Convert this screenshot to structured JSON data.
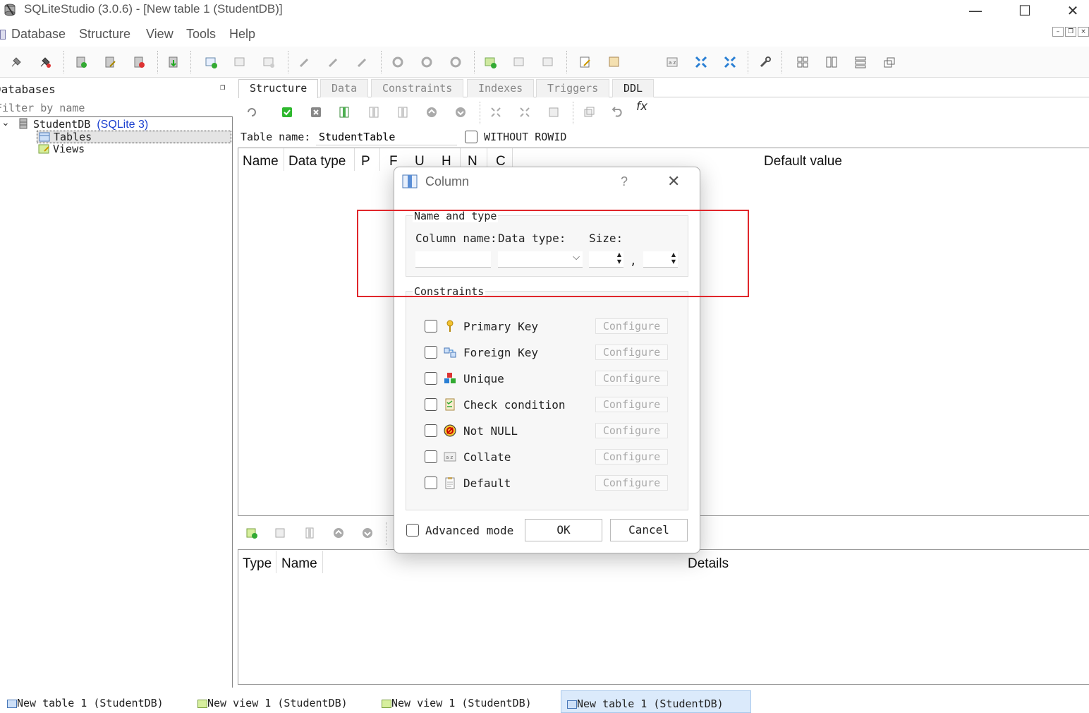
{
  "window": {
    "title": "SQLiteStudio (3.0.6) - [New table 1 (StudentDB)]",
    "minimize": "—",
    "maximize": "☐",
    "close": "✕"
  },
  "menu": [
    "Database",
    "Structure",
    "View",
    "Tools",
    "Help"
  ],
  "db_panel": {
    "header": "Databases",
    "filter_placeholder": "Filter by name",
    "db_name": "StudentDB",
    "db_type": "(SQLite 3)",
    "tables": "Tables",
    "views": "Views"
  },
  "tabs": [
    "Structure",
    "Data",
    "Constraints",
    "Indexes",
    "Triggers",
    "DDL"
  ],
  "structure": {
    "table_name_label": "Table name:",
    "table_name_value": "StudentTable",
    "without_rowid": "WITHOUT ROWID",
    "columns": [
      "Name",
      "Data type",
      "P",
      "F",
      "U",
      "H",
      "N",
      "C",
      "Default value"
    ],
    "constraint_columns": [
      "Type",
      "Name",
      "Details"
    ]
  },
  "dialog": {
    "title": "Column",
    "help": "?",
    "close": "✕",
    "name_type_group": "Name and type",
    "column_name_label": "Column name:",
    "data_type_label": "Data type:",
    "size_label": "Size:",
    "size_separator": ",",
    "constraints_group": "Constraints",
    "constraints": [
      {
        "label": "Primary Key",
        "button": "Configure"
      },
      {
        "label": "Foreign Key",
        "button": "Configure"
      },
      {
        "label": "Unique",
        "button": "Configure"
      },
      {
        "label": "Check condition",
        "button": "Configure"
      },
      {
        "label": "Not NULL",
        "button": "Configure"
      },
      {
        "label": "Collate",
        "button": "Configure"
      },
      {
        "label": "Default",
        "button": "Configure"
      }
    ],
    "advanced_mode": "Advanced mode",
    "ok": "OK",
    "cancel": "Cancel"
  },
  "taskbar": [
    "New table 1 (StudentDB)",
    "New view 1 (StudentDB)",
    "New view 1 (StudentDB)",
    "New table 1 (StudentDB)"
  ],
  "colors": {
    "highlight": "#e0262b",
    "db_type": "#1a3fcf",
    "active_task": "#dbeafb"
  }
}
